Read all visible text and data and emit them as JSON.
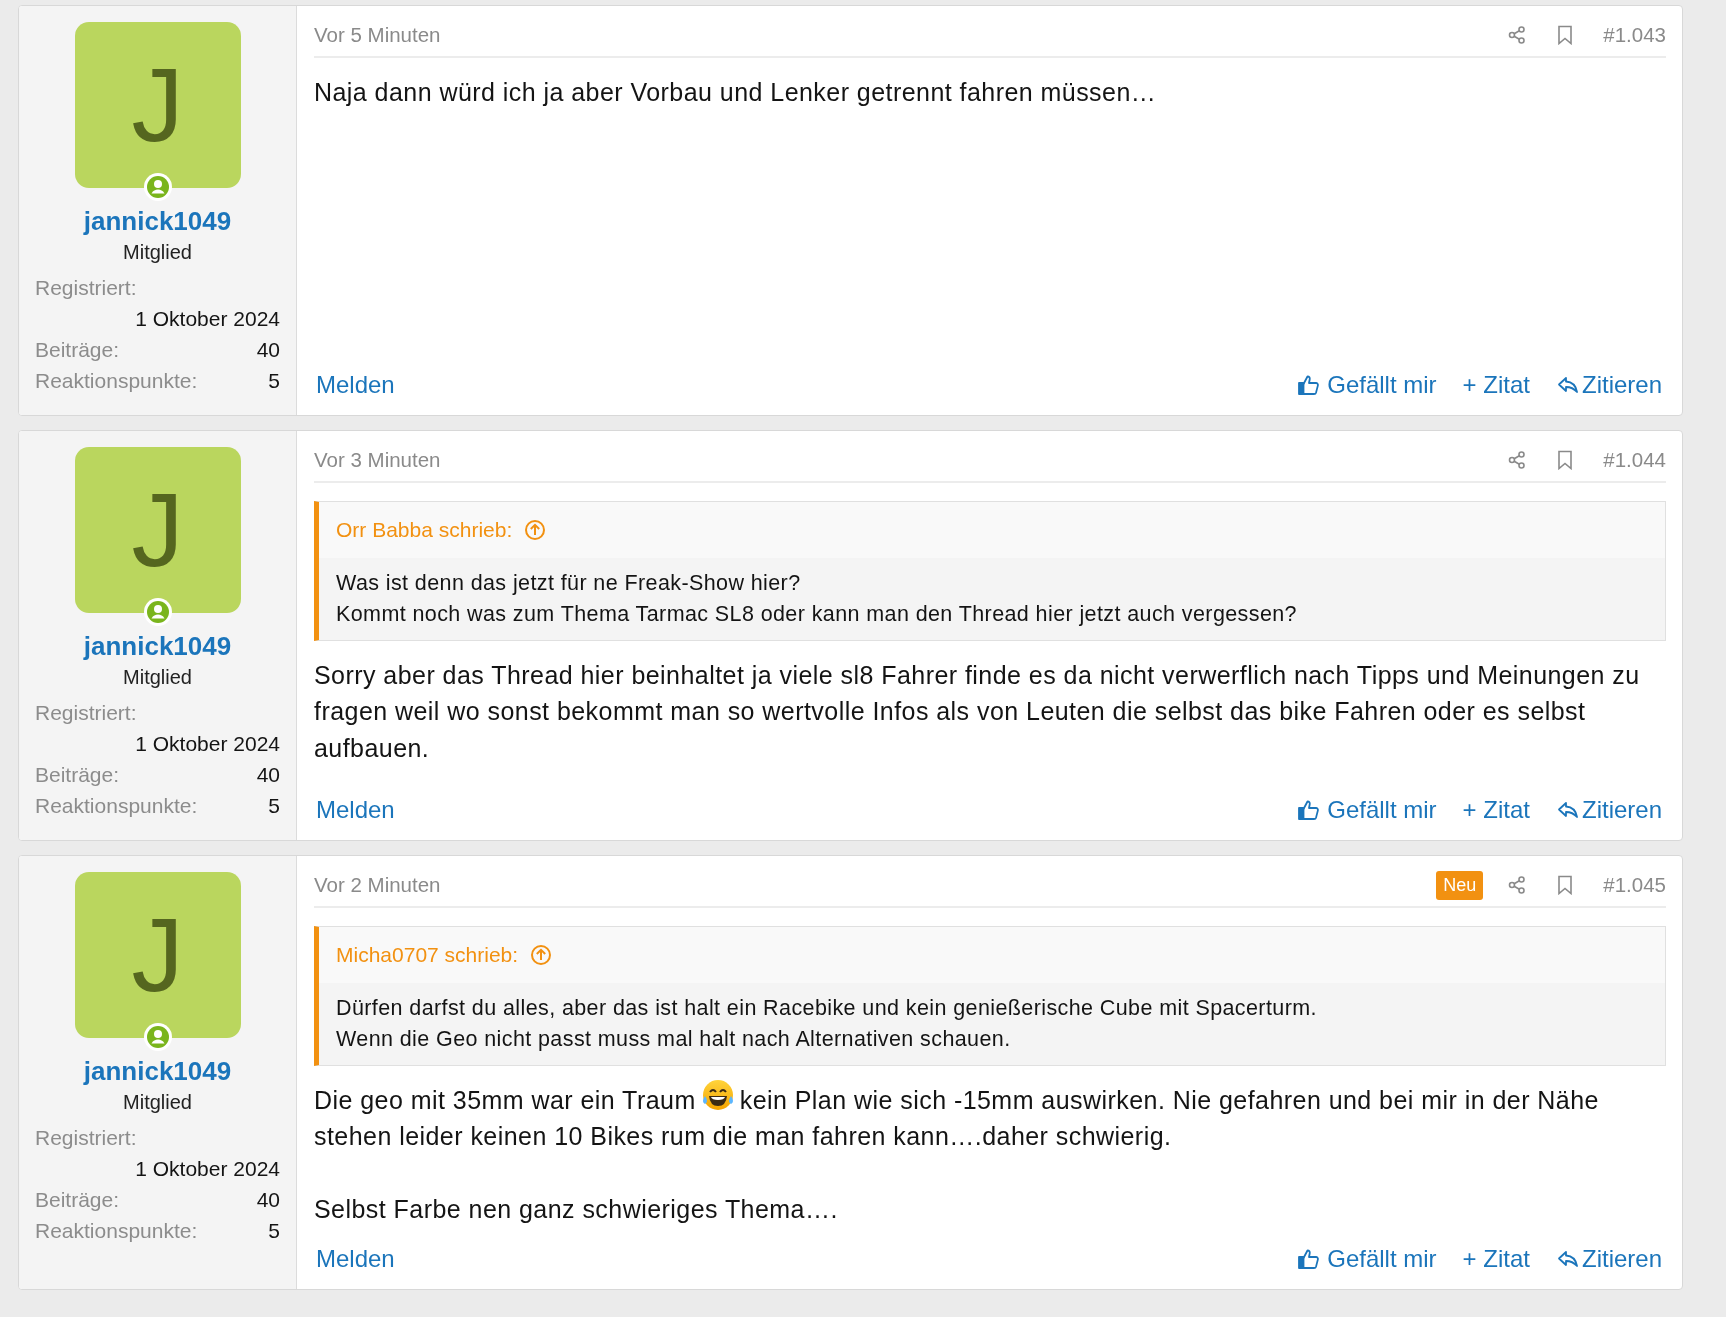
{
  "posts": [
    {
      "user": {
        "initial": "J",
        "name": "jannick1049",
        "online": true,
        "role": "Mitglied",
        "stats": [
          {
            "label": "Registriert:",
            "value": "1 Oktober 2024",
            "kind": "block"
          },
          {
            "label": "Beiträge:",
            "value": "40",
            "kind": "inline"
          },
          {
            "label": "Reaktionspunkte:",
            "value": "5",
            "kind": "inline"
          }
        ]
      },
      "time": "Vor 5 Minuten",
      "number": "#1.043",
      "paragraphs": [
        [
          {
            "kind": "text",
            "text": "Naja dann würd ich ja aber Vorbau und Lenker getrennt fahren müssen…"
          }
        ]
      ],
      "actions": {
        "report": "Melden",
        "like": "Gefällt mir",
        "multiquote": "+ Zitat",
        "reply": "Zitieren"
      }
    },
    {
      "user": {
        "initial": "J",
        "name": "jannick1049",
        "online": true,
        "role": "Mitglied",
        "stats": [
          {
            "label": "Registriert:",
            "value": "1 Oktober 2024",
            "kind": "block"
          },
          {
            "label": "Beiträge:",
            "value": "40",
            "kind": "inline"
          },
          {
            "label": "Reaktionspunkte:",
            "value": "5",
            "kind": "inline"
          }
        ]
      },
      "time": "Vor 3 Minuten",
      "number": "#1.044",
      "quote": {
        "author": "Orr Babba schrieb:",
        "lines": [
          "Was ist denn das jetzt für ne Freak-Show hier?",
          "Kommt noch was zum Thema Tarmac SL8 oder kann man den Thread hier jetzt auch vergessen?"
        ]
      },
      "paragraphs": [
        [
          {
            "kind": "text",
            "text": "Sorry aber das Thread hier beinhaltet ja viele sl8 Fahrer finde es da nicht verwerflich nach Tipps und Meinungen zu fragen weil wo sonst bekommt man so wertvolle Infos als von Leuten die selbst das bike Fahren oder es selbst aufbauen."
          }
        ]
      ],
      "actions": {
        "report": "Melden",
        "like": "Gefällt mir",
        "multiquote": "+ Zitat",
        "reply": "Zitieren"
      }
    },
    {
      "user": {
        "initial": "J",
        "name": "jannick1049",
        "online": true,
        "role": "Mitglied",
        "stats": [
          {
            "label": "Registriert:",
            "value": "1 Oktober 2024",
            "kind": "block"
          },
          {
            "label": "Beiträge:",
            "value": "40",
            "kind": "inline"
          },
          {
            "label": "Reaktionspunkte:",
            "value": "5",
            "kind": "inline"
          }
        ]
      },
      "time": "Vor 2 Minuten",
      "badge": "Neu",
      "number": "#1.045",
      "quote": {
        "author": "Micha0707 schrieb:",
        "lines": [
          "Dürfen darfst du alles, aber das ist halt ein Racebike und kein genießerische Cube mit Spacerturm.",
          "Wenn die Geo nicht passt muss mal halt nach Alternativen schauen."
        ]
      },
      "paragraphs": [
        [
          {
            "kind": "text",
            "text": "Die geo mit 35mm war ein Traum"
          },
          {
            "kind": "emoji"
          },
          {
            "kind": "text",
            "text": "kein Plan wie sich -15mm auswirken. Nie gefahren und bei mir in der Nähe"
          },
          {
            "kind": "line",
            "text": "stehen leider keinen 10 Bikes rum die man fahren kann….daher schwierig."
          }
        ],
        [
          {
            "kind": "text",
            "text": "Selbst Farbe nen ganz schwieriges Thema…."
          }
        ]
      ],
      "actions": {
        "report": "Melden",
        "like": "Gefällt mir",
        "multiquote": "+ Zitat",
        "reply": "Zitieren"
      }
    }
  ]
}
